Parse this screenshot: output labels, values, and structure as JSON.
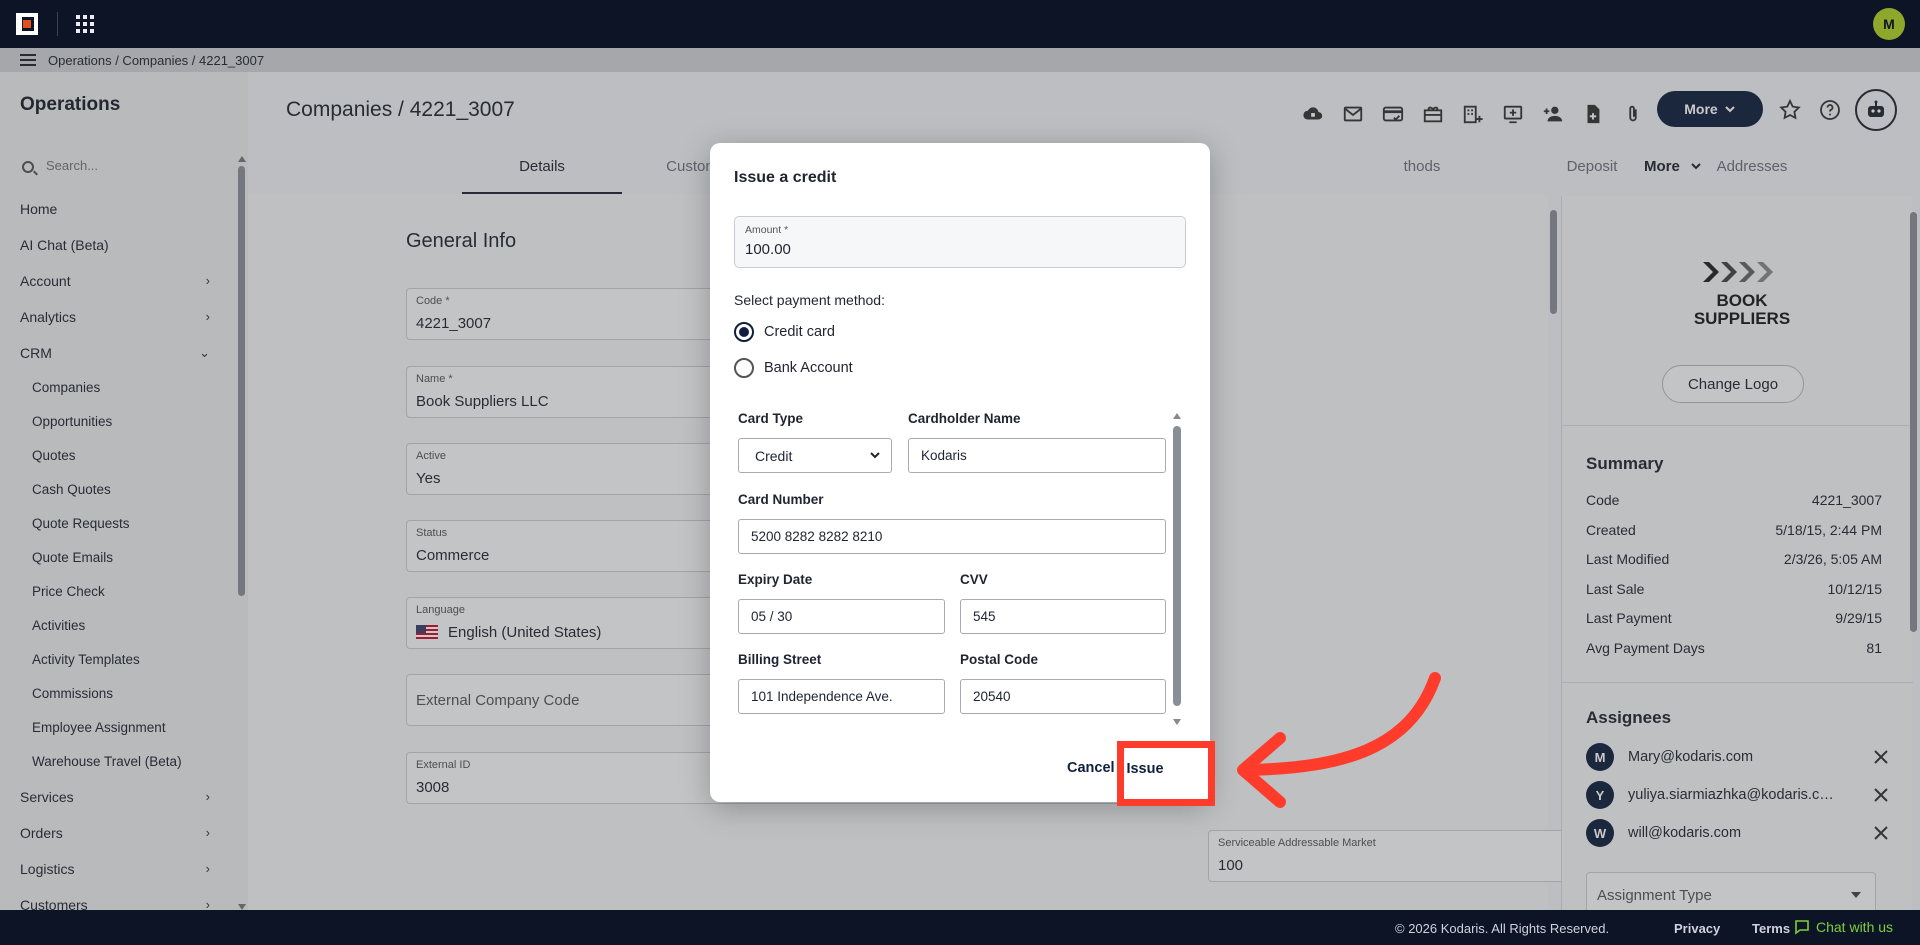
{
  "topbar": {
    "user_initial": "M"
  },
  "breadcrumb": {
    "text": "Operations / Companies / 4221_3007"
  },
  "sidebar": {
    "title": "Operations",
    "search_placeholder": "Search...",
    "items": [
      {
        "label": "Home"
      },
      {
        "label": "AI Chat (Beta)"
      },
      {
        "label": "Account",
        "chevron": "›"
      },
      {
        "label": "Analytics",
        "chevron": "›"
      },
      {
        "label": "CRM",
        "chevron": "⌄"
      },
      {
        "label": "Companies"
      },
      {
        "label": "Opportunities"
      },
      {
        "label": "Quotes"
      },
      {
        "label": "Cash Quotes"
      },
      {
        "label": "Quote Requests"
      },
      {
        "label": "Quote Emails"
      },
      {
        "label": "Price Check"
      },
      {
        "label": "Activities"
      },
      {
        "label": "Activity Templates"
      },
      {
        "label": "Commissions"
      },
      {
        "label": "Employee Assignment"
      },
      {
        "label": "Warehouse Travel (Beta)"
      },
      {
        "label": "Services",
        "chevron": "›"
      },
      {
        "label": "Orders",
        "chevron": "›"
      },
      {
        "label": "Logistics",
        "chevron": "›"
      },
      {
        "label": "Customers",
        "chevron": "›"
      }
    ]
  },
  "main": {
    "title": "Companies / 4221_3007",
    "more_label": "More",
    "tabs": [
      {
        "label": "Details"
      },
      {
        "label": "Custom"
      },
      {
        "label": "thods"
      },
      {
        "label": "Deposit"
      },
      {
        "label": "Addresses"
      },
      {
        "label": "More"
      }
    ],
    "section_title": "General Info",
    "fields": {
      "code": {
        "label": "Code *",
        "value": "4221_3007"
      },
      "name": {
        "label": "Name *",
        "value": "Book Suppliers LLC"
      },
      "active": {
        "label": "Active",
        "value": "Yes"
      },
      "status": {
        "label": "Status",
        "value": "Commerce"
      },
      "language": {
        "label": "Language",
        "value": "English (United States)"
      },
      "external_code": {
        "placeholder": "External Company Code"
      },
      "external_id": {
        "label": "External ID",
        "value": "3008"
      },
      "sam": {
        "label": "Serviceable Addressable Market",
        "value": "100"
      }
    }
  },
  "right_panel": {
    "logo_text": "BOOK SUPPLIERS",
    "change_logo_label": "Change Logo",
    "summary_title": "Summary",
    "summary": [
      {
        "label": "Code",
        "value": "4221_3007"
      },
      {
        "label": "Created",
        "value": "5/18/15, 2:44 PM"
      },
      {
        "label": "Last Modified",
        "value": "2/3/26, 5:05 AM"
      },
      {
        "label": "Last Sale",
        "value": "10/12/15"
      },
      {
        "label": "Last Payment",
        "value": "9/29/15"
      },
      {
        "label": "Avg Payment Days",
        "value": "81"
      }
    ],
    "assignees_title": "Assignees",
    "assignees": [
      {
        "initial": "M",
        "email": "Mary@kodaris.com"
      },
      {
        "initial": "Y",
        "email": "yuliya.siarmiazhka@kodaris.com"
      },
      {
        "initial": "W",
        "email": "will@kodaris.com"
      }
    ],
    "assignment_type_placeholder": "Assignment Type"
  },
  "modal": {
    "title": "Issue a credit",
    "amount_label": "Amount *",
    "amount_value": "100.00",
    "payment_method_label": "Select payment method:",
    "methods": [
      {
        "label": "Credit card",
        "selected": true
      },
      {
        "label": "Bank Account",
        "selected": false
      }
    ],
    "card_type_label": "Card Type",
    "card_type_value": "Credit",
    "cardholder_label": "Cardholder Name",
    "cardholder_value": "Kodaris",
    "card_number_label": "Card Number",
    "card_number_value": "5200 8282 8282 8210",
    "expiry_label": "Expiry Date",
    "expiry_value": "05 / 30",
    "cvv_label": "CVV",
    "cvv_value": "545",
    "street_label": "Billing Street",
    "street_value": "101 Independence Ave.",
    "postal_label": "Postal Code",
    "postal_value": "20540",
    "cancel_label": "Cancel",
    "issue_label": "Issue"
  },
  "footer": {
    "copyright": "© 2026 Kodaris. All Rights Reserved.",
    "privacy": "Privacy",
    "terms": "Terms",
    "chat": "Chat with us"
  },
  "colors": {
    "navy": "#0f1f3d",
    "topbar": "#0d1426",
    "highlight": "#ff3b2b",
    "chat_green": "#7ccf3a"
  }
}
